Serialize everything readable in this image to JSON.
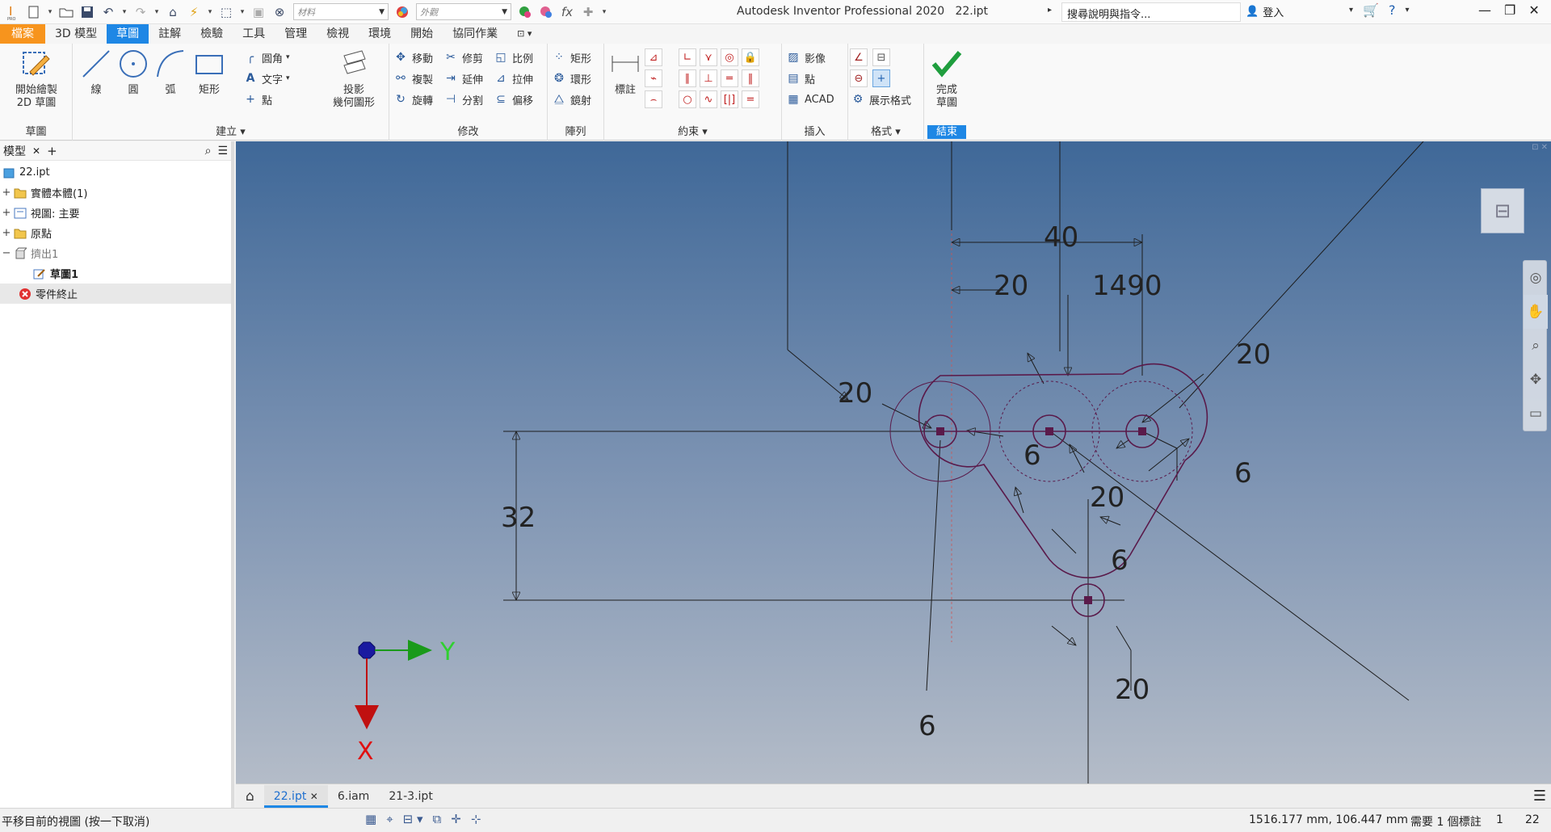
{
  "titlebar": {
    "title": "Autodesk Inventor Professional 2020",
    "file": "22.ipt",
    "search_placeholder": "搜尋說明與指令...",
    "user": "登入",
    "material_combo": "材料",
    "appearance_combo": "外觀",
    "formula_icon": "fx"
  },
  "tabs": [
    "檔案",
    "3D 模型",
    "草圖",
    "註解",
    "檢驗",
    "工具",
    "管理",
    "檢視",
    "環境",
    "開始",
    "協同作業"
  ],
  "ribbon": {
    "sketch_panel": {
      "title": "草圖",
      "start_line1": "開始繪製",
      "start_line2": "2D 草圖"
    },
    "create_panel": {
      "title": "建立",
      "line": "線",
      "circle": "圓",
      "arc": "弧",
      "rect": "矩形",
      "fillet": "圓角",
      "text": "文字",
      "point": "點",
      "project_line1": "投影",
      "project_line2": "幾何圖形"
    },
    "modify_panel": {
      "title": "修改",
      "move": "移動",
      "trim": "修剪",
      "scale": "比例",
      "copy": "複製",
      "extend": "延伸",
      "stretch": "拉伸",
      "rotate": "旋轉",
      "split": "分割",
      "offset": "偏移"
    },
    "pattern_panel": {
      "title": "陣列",
      "rect": "矩形",
      "circular": "環形",
      "mirror": "鏡射"
    },
    "constrain_panel": {
      "title": "約束",
      "dimension": "標註"
    },
    "insert_panel": {
      "title": "插入",
      "image": "影像",
      "points": "點",
      "acad": "ACAD"
    },
    "format_panel": {
      "title": "格式",
      "show_format": "展示格式"
    },
    "exit_panel": {
      "title": "結束",
      "finish_line1": "完成",
      "finish_line2": "草圖"
    }
  },
  "browser": {
    "title": "模型",
    "items": [
      {
        "label": "22.ipt",
        "expander": ""
      },
      {
        "label": "實體本體(1)",
        "expander": "+"
      },
      {
        "label": "視圖: 主要",
        "expander": "+"
      },
      {
        "label": "原點",
        "expander": "+"
      },
      {
        "label": "擠出1",
        "expander": "−"
      },
      {
        "label": "草圖1",
        "expander": ""
      },
      {
        "label": "零件終止",
        "expander": ""
      }
    ]
  },
  "sketch": {
    "dimensions": [
      "40",
      "20",
      "1490",
      "20",
      "20",
      "6",
      "20",
      "6",
      "32",
      "6",
      "20",
      "6"
    ],
    "axis_y": "Y",
    "axis_x": "X"
  },
  "doctabs": [
    "22.ipt",
    "6.iam",
    "21-3.ipt"
  ],
  "status": {
    "message": "平移目前的視圖 (按一下取消)",
    "coords": "1516.177 mm, 106.447 mm",
    "need": "需要 1 個標註",
    "count1": "1",
    "count2": "22"
  },
  "colors": {
    "accent": "#1e87e5",
    "file_tab": "#f7941d",
    "sketch_geometry": "#5a1a4a",
    "finish_check": "#1f9e3e"
  }
}
